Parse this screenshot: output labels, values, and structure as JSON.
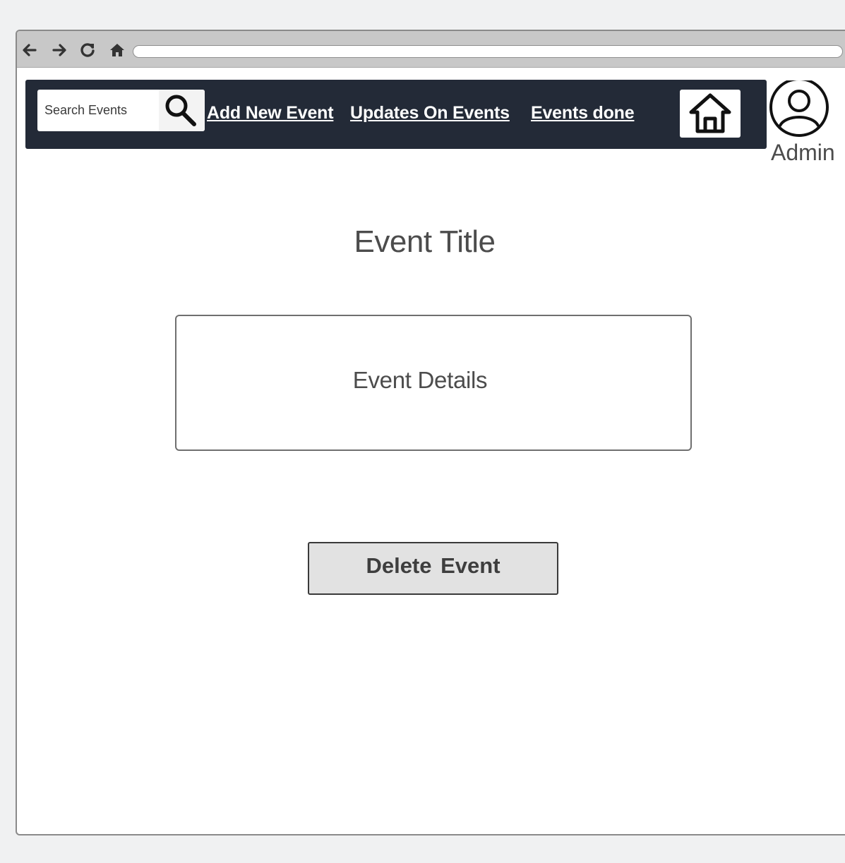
{
  "browser": {
    "back_icon": "arrow-left-icon",
    "forward_icon": "arrow-right-icon",
    "reload_icon": "reload-icon",
    "home_icon": "home-icon",
    "address": ""
  },
  "navbar": {
    "search": {
      "placeholder": "Search Events",
      "icon": "search-icon"
    },
    "links": [
      {
        "label": "Add New Event"
      },
      {
        "label": "Updates On Events"
      },
      {
        "label": "Events done"
      }
    ],
    "home_icon": "home-icon"
  },
  "user": {
    "avatar_icon": "user-circle-icon",
    "label": "Admin"
  },
  "main": {
    "title": "Event Title",
    "details": "Event Details",
    "delete_button": "Delete Event"
  },
  "colors": {
    "navbar_bg": "#232a37",
    "page_bg": "#f0f1f2",
    "button_bg": "#e2e2e2",
    "text": "#4c4c4c"
  }
}
